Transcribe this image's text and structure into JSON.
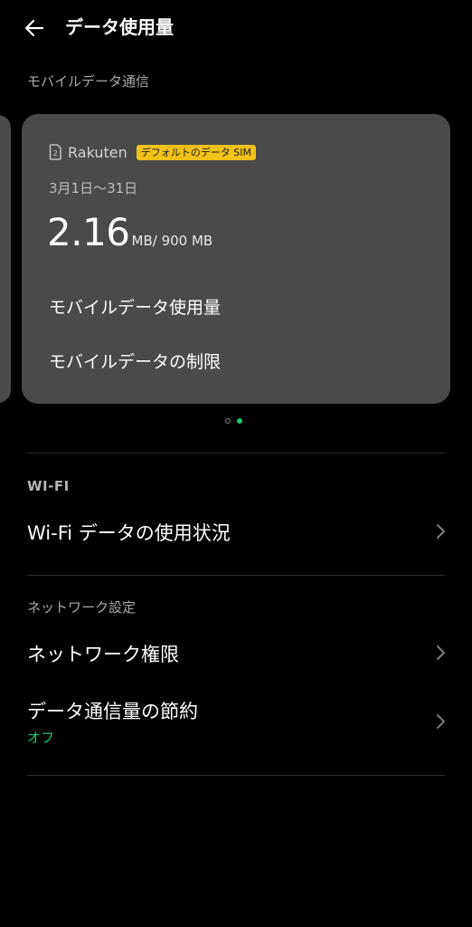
{
  "header": {
    "title": "データ使用量",
    "back_icon": "back-arrow-icon"
  },
  "mobile_section": {
    "label": "モバイルデータ通信",
    "card": {
      "sim_icon": "sim-2-icon",
      "sim_number": "2",
      "carrier": "Rakuten",
      "default_badge": "デフォルトのデータ SIM",
      "period": "3月1日〜31日",
      "usage_value": "2.16",
      "usage_unit": "MB",
      "usage_limit": "/ 900 MB",
      "link_usage": "モバイルデータ使用量",
      "link_limit": "モバイルデータの制限"
    },
    "pager": {
      "total": 2,
      "active_index": 1
    }
  },
  "wifi_section": {
    "label": "WI-FI",
    "usage_label": "Wi-Fi データの使用状況"
  },
  "network_section": {
    "label": "ネットワーク設定",
    "permissions_label": "ネットワーク権限",
    "data_saver_label": "データ通信量の節約",
    "data_saver_status": "オフ"
  },
  "colors": {
    "background": "#000000",
    "card": "#4a4a4a",
    "accent_green": "#1fc96e",
    "badge_yellow": "#f2c11a"
  },
  "icons": {
    "chevron": "chevron-right-icon"
  }
}
